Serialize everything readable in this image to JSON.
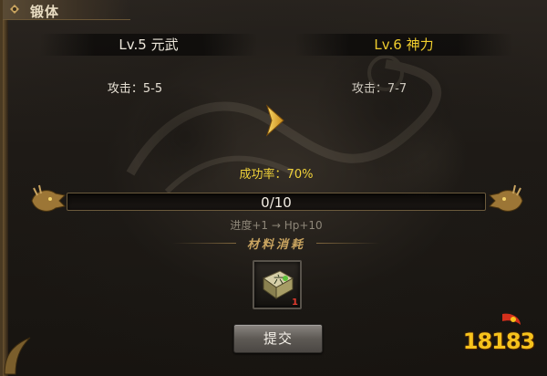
{
  "window": {
    "title": "锻体"
  },
  "current": {
    "level": "Lv.5 元武",
    "attack": "攻击：5-5"
  },
  "next": {
    "level": "Lv.6 神力",
    "attack": "攻击：7-7"
  },
  "success_rate": "成功率：70%",
  "progress": {
    "text": "0/10",
    "fraction": 0.0,
    "bonus": "进度+1 → Hp+10"
  },
  "materials": {
    "title": "材料消耗",
    "item_glyph": "六",
    "item_count": "1"
  },
  "submit_label": "提交",
  "logo": {
    "text": "18183"
  },
  "colors": {
    "accent_gold": "#f2cf2e",
    "success_yellow": "#f0d23a",
    "count_red": "#e23b2e"
  },
  "icons": [
    "dragon-head-icon",
    "right-arrow-icon",
    "skill-book-icon"
  ]
}
